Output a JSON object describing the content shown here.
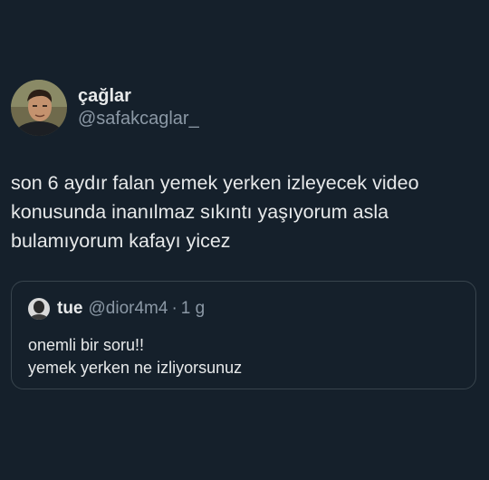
{
  "post": {
    "display_name": "çağlar",
    "handle": "@safakcaglar_",
    "text": "son 6 aydır falan yemek yerken izleyecek video\nkonusunda inanılmaz sıkıntı yaşıyorum asla\nbulamıyorum kafayı yicez",
    "avatar_icon": "profile-photo"
  },
  "quote": {
    "display_name": "tue",
    "handle": "@dior4m4",
    "separator": "·",
    "time": "1 g",
    "text": "onemli bir soru!!\nyemek yerken ne izliyorsunuz",
    "avatar_icon": "profile-photo"
  },
  "colors": {
    "background": "#15202b",
    "primary_text": "#e7e9ea",
    "secondary_text": "#8b98a5",
    "border": "#38444d"
  }
}
